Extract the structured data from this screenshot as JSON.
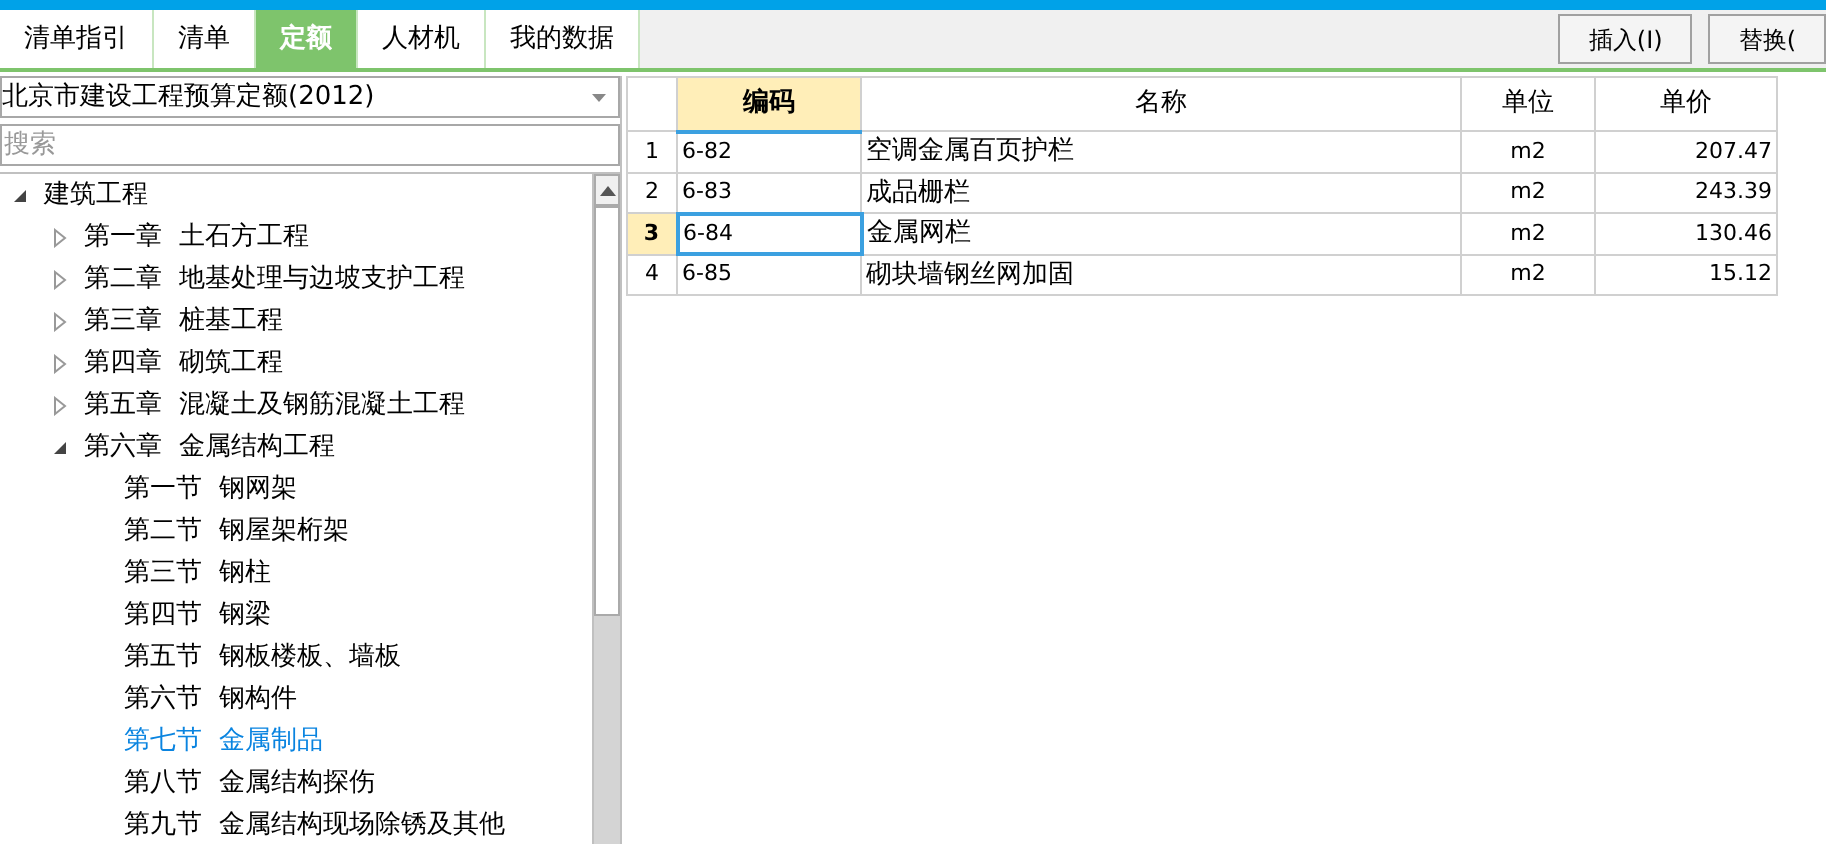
{
  "tabs": [
    {
      "label": "清单指引",
      "selected": false
    },
    {
      "label": "清单",
      "selected": false
    },
    {
      "label": "定额",
      "selected": true
    },
    {
      "label": "人材机",
      "selected": false
    },
    {
      "label": "我的数据",
      "selected": false
    }
  ],
  "toolbar_buttons": [
    "插入(I)",
    "替换("
  ],
  "library_select": {
    "value": "北京市建设工程预算定额(2012)"
  },
  "search": {
    "placeholder": "搜索"
  },
  "tree": [
    {
      "label": "建筑工程",
      "expanded": true,
      "selected": false,
      "children": [
        {
          "label": "第一章  土石方工程",
          "expanded": false,
          "selected": false
        },
        {
          "label": "第二章  地基处理与边坡支护工程",
          "expanded": false,
          "selected": false
        },
        {
          "label": "第三章  桩基工程",
          "expanded": false,
          "selected": false
        },
        {
          "label": "第四章  砌筑工程",
          "expanded": false,
          "selected": false
        },
        {
          "label": "第五章  混凝土及钢筋混凝土工程",
          "expanded": false,
          "selected": false
        },
        {
          "label": "第六章  金属结构工程",
          "expanded": true,
          "selected": false,
          "children": [
            {
              "label": "第一节  钢网架",
              "selected": false
            },
            {
              "label": "第二节  钢屋架桁架",
              "selected": false
            },
            {
              "label": "第三节  钢柱",
              "selected": false
            },
            {
              "label": "第四节  钢梁",
              "selected": false
            },
            {
              "label": "第五节  钢板楼板、墙板",
              "selected": false
            },
            {
              "label": "第六节  钢构件",
              "selected": false
            },
            {
              "label": "第七节  金属制品",
              "selected": true
            },
            {
              "label": "第八节  金属结构探伤",
              "selected": false
            },
            {
              "label": "第九节  金属结构现场除锈及其他",
              "selected": false
            }
          ]
        }
      ]
    }
  ],
  "table": {
    "columns": [
      "编码",
      "名称",
      "单位",
      "单价"
    ],
    "rows": [
      {
        "index": "1",
        "code": "6-82",
        "name": "空调金属百页护栏",
        "unit": "m2",
        "price": "207.47",
        "selected": false
      },
      {
        "index": "2",
        "code": "6-83",
        "name": "成品栅栏",
        "unit": "m2",
        "price": "243.39",
        "selected": false
      },
      {
        "index": "3",
        "code": "6-84",
        "name": "金属网栏",
        "unit": "m2",
        "price": "130.46",
        "selected": true
      },
      {
        "index": "4",
        "code": "6-85",
        "name": "砌块墙钢丝网加固",
        "unit": "m2",
        "price": "15.12",
        "selected": false
      }
    ]
  }
}
